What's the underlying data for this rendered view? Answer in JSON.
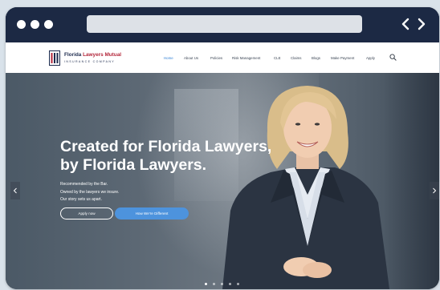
{
  "browser": {
    "icons": [
      "dot-icon",
      "chevron-left-icon",
      "chevron-right-icon"
    ]
  },
  "header": {
    "logo": {
      "name_primary": "Florida",
      "name_accent": "Lawyers Mutual",
      "subtitle": "INSURANCE COMPANY"
    },
    "nav": [
      "Home",
      "About Us",
      "Policies",
      "Risk Management",
      "CLE",
      "Claims",
      "Blogs",
      "Make Payment",
      "Apply"
    ],
    "active_nav": "Home",
    "colors": {
      "navy": "#1c2a4d",
      "accent": "#b3263a",
      "active": "#2f7fd4"
    }
  },
  "hero": {
    "headline_line1": "Created for Florida Lawyers,",
    "headline_line2": "by Florida Lawyers.",
    "sub_line1": "Recommended by the Bar.",
    "sub_line2": "Owned by the lawyers we insure.",
    "sub_line3": "Our story sets us apart.",
    "button_primary": "Apply now",
    "button_secondary": "How We're Different",
    "slides_count": 5,
    "active_slide": 1,
    "colors": {
      "button_blue": "#4d93dd"
    }
  }
}
